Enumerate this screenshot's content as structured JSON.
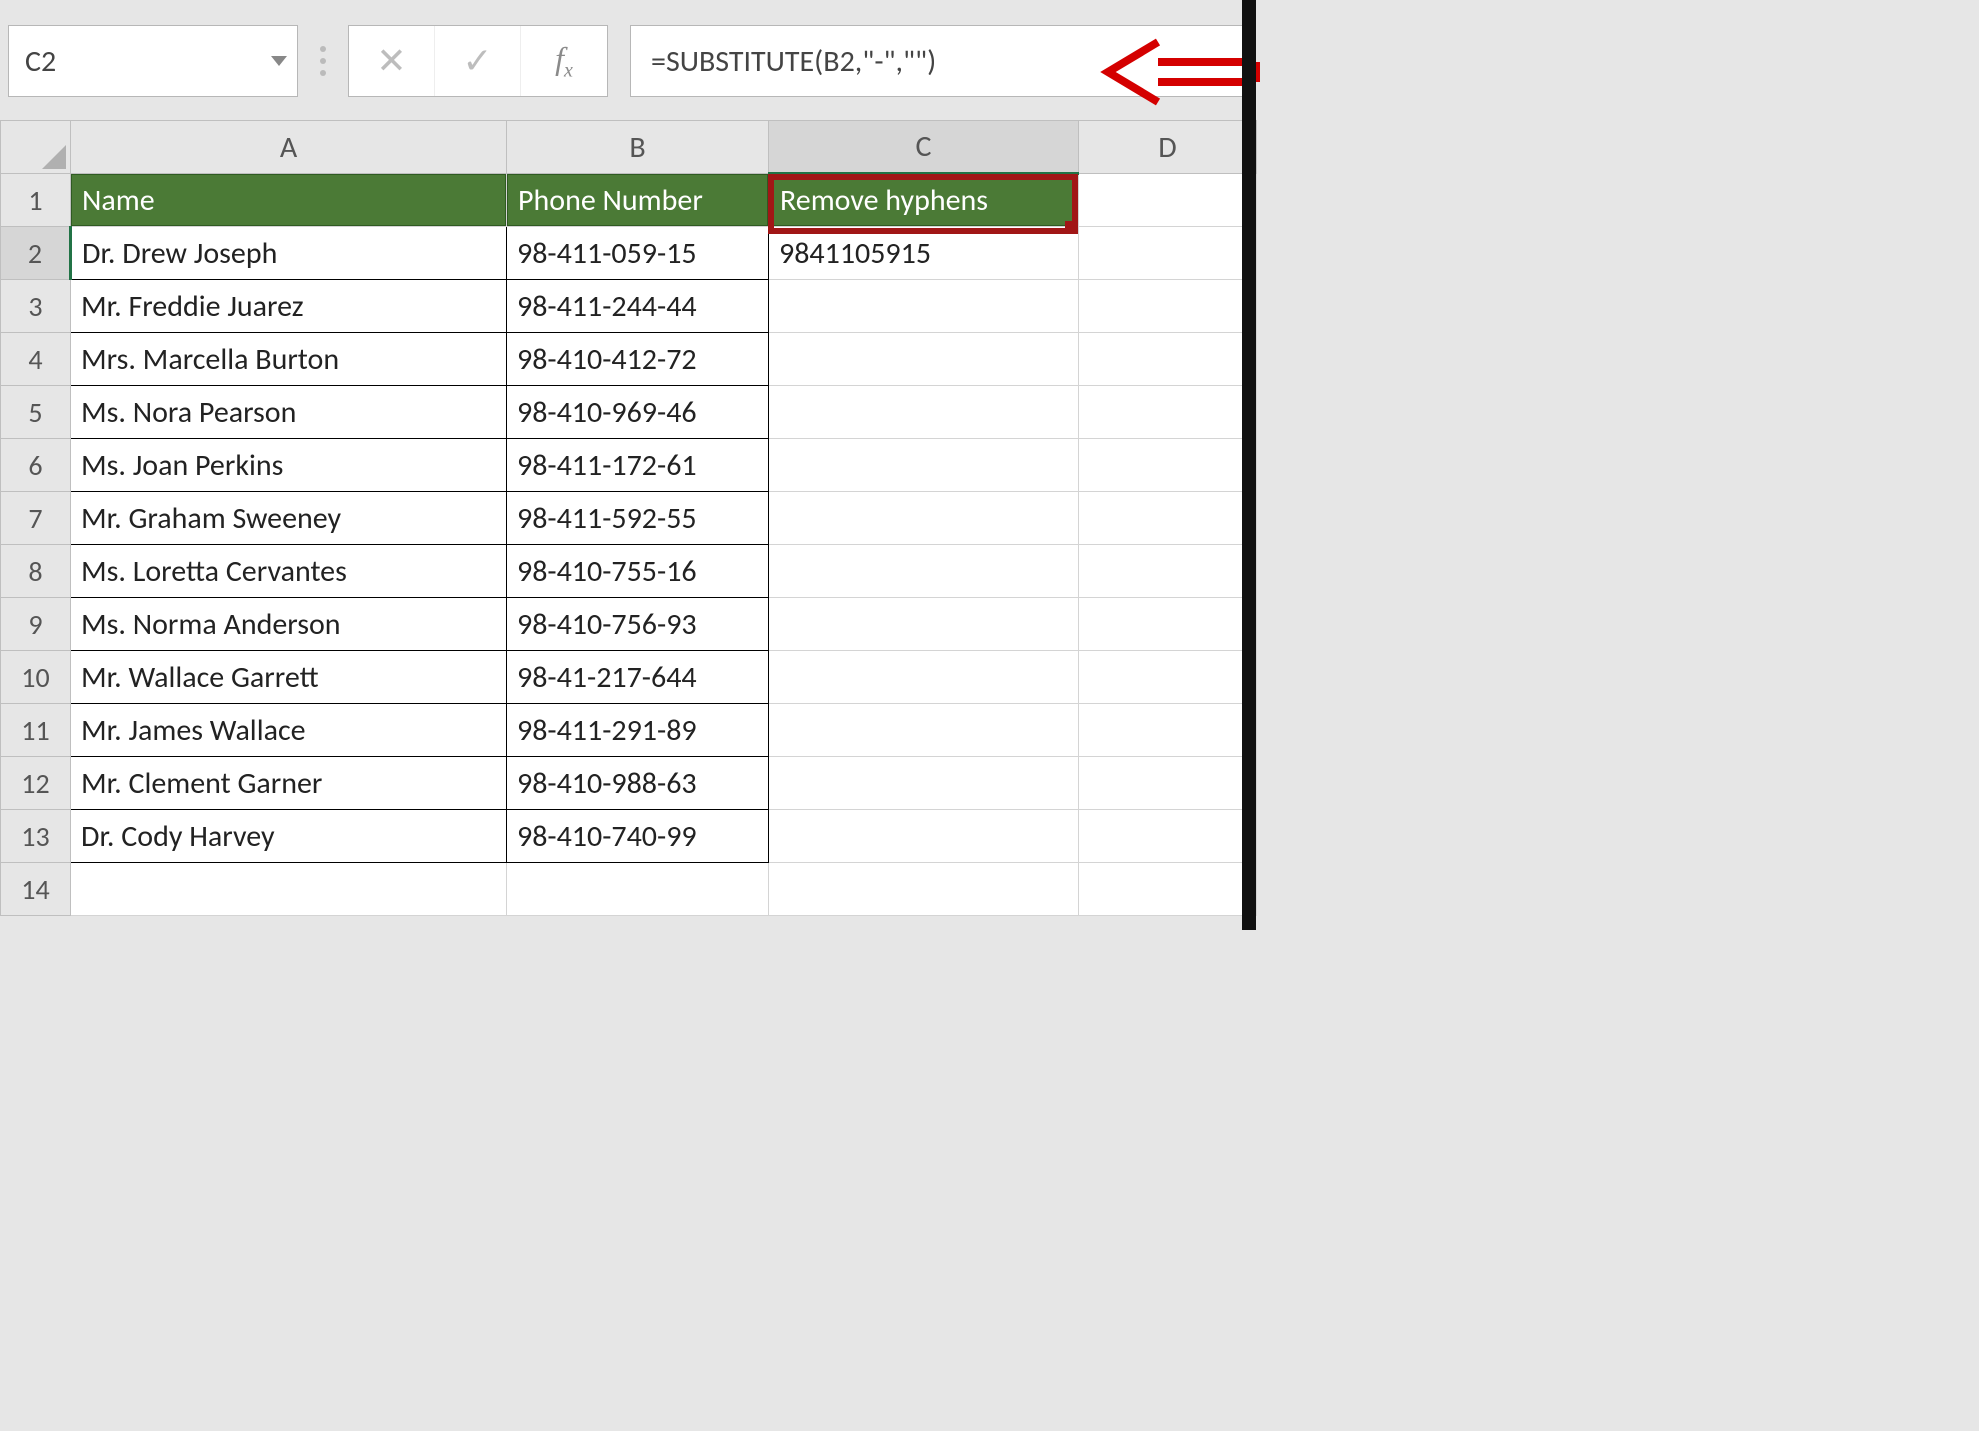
{
  "name_box": {
    "value": "C2"
  },
  "formula_bar": {
    "formula": "=SUBSTITUTE(B2,\"-\",\"\")"
  },
  "fx_label": "fx",
  "columns": [
    "A",
    "B",
    "C",
    "D"
  ],
  "selected_column": "C",
  "selected_row": 2,
  "headers": {
    "A": "Name",
    "B": "Phone Number",
    "C": "Remove hyphens"
  },
  "rows": [
    {
      "n": 1,
      "A": "Name",
      "B": "Phone Number",
      "C": "Remove hyphens"
    },
    {
      "n": 2,
      "A": "Dr. Drew Joseph",
      "B": "98-411-059-15",
      "C": "9841105915"
    },
    {
      "n": 3,
      "A": "Mr. Freddie Juarez",
      "B": "98-411-244-44",
      "C": ""
    },
    {
      "n": 4,
      "A": "Mrs. Marcella Burton",
      "B": "98-410-412-72",
      "C": ""
    },
    {
      "n": 5,
      "A": "Ms. Nora Pearson",
      "B": "98-410-969-46",
      "C": ""
    },
    {
      "n": 6,
      "A": "Ms. Joan Perkins",
      "B": "98-411-172-61",
      "C": ""
    },
    {
      "n": 7,
      "A": "Mr. Graham Sweeney",
      "B": "98-411-592-55",
      "C": ""
    },
    {
      "n": 8,
      "A": "Ms. Loretta Cervantes",
      "B": "98-410-755-16",
      "C": ""
    },
    {
      "n": 9,
      "A": "Ms. Norma Anderson",
      "B": "98-410-756-93",
      "C": ""
    },
    {
      "n": 10,
      "A": "Mr. Wallace Garrett",
      "B": "98-41-217-644",
      "C": ""
    },
    {
      "n": 11,
      "A": "Mr. James Wallace",
      "B": "98-411-291-89",
      "C": ""
    },
    {
      "n": 12,
      "A": "Mr. Clement Garner",
      "B": "98-410-988-63",
      "C": ""
    },
    {
      "n": 13,
      "A": "Dr. Cody Harvey",
      "B": "98-410-740-99",
      "C": ""
    },
    {
      "n": 14,
      "A": "",
      "B": "",
      "C": ""
    }
  ],
  "icons": {
    "cancel": "✕",
    "enter": "✓"
  },
  "annotation": {
    "arrow_color": "#d40000"
  },
  "chart_data": null
}
